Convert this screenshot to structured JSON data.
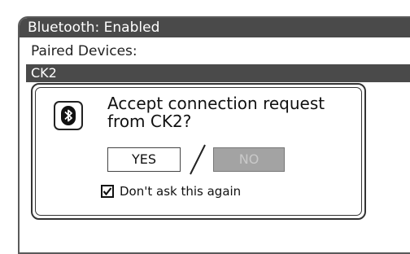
{
  "header": {
    "title": "Bluetooth: Enabled"
  },
  "paired": {
    "label": "Paired Devices:",
    "devices": [
      {
        "name": "CK2"
      }
    ]
  },
  "dialog": {
    "message_line1": "Accept connection request",
    "message_line2": "from CK2?",
    "yes_label": "YES",
    "no_label": "NO",
    "checkbox_label": "Don't ask this again",
    "checkbox_checked": true
  },
  "colors": {
    "bar": "#4a4a4a",
    "no_button": "#a3a3a3"
  },
  "icons": {
    "dialog_icon": "bluetooth-icon"
  }
}
